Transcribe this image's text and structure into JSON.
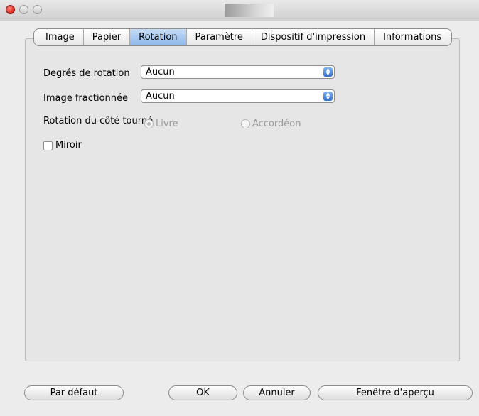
{
  "window": {
    "buttons": [
      "close",
      "minimize",
      "zoom"
    ]
  },
  "tabs": [
    {
      "label": "Image",
      "active": false
    },
    {
      "label": "Papier",
      "active": false
    },
    {
      "label": "Rotation",
      "active": true
    },
    {
      "label": "Paramètre",
      "active": false
    },
    {
      "label": "Dispositif d'impression",
      "active": false
    },
    {
      "label": "Informations",
      "active": false
    }
  ],
  "rotation": {
    "degrees_label": "Degrés de rotation",
    "degrees_value": "Aucun",
    "split_label": "Image fractionnée",
    "split_value": "Aucun",
    "side_label": "Rotation du côté tourné",
    "radio_livre": "Livre",
    "radio_accordeon": "Accordéon",
    "mirror_label": "Miroir"
  },
  "footer": {
    "default_label": "Par défaut",
    "ok_label": "OK",
    "cancel_label": "Annuler",
    "preview_label": "Fenêtre d'aperçu"
  }
}
